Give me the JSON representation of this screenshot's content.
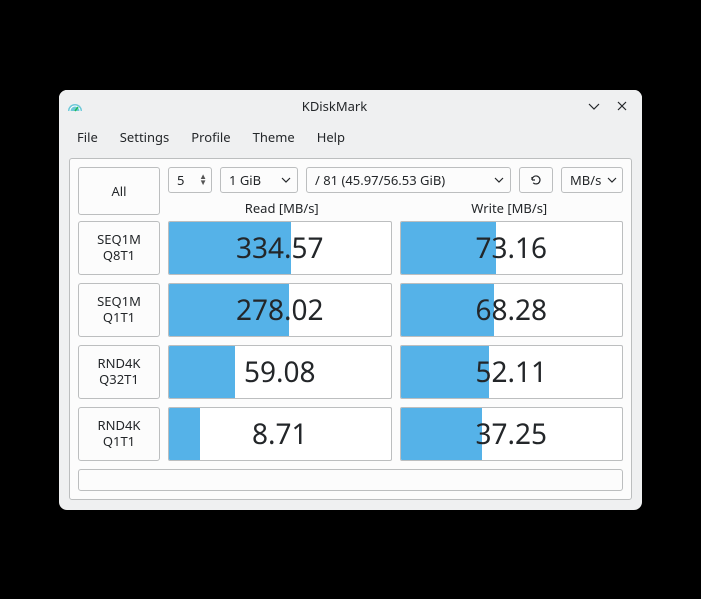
{
  "window": {
    "title": "KDiskMark"
  },
  "menu": {
    "file": "File",
    "settings": "Settings",
    "profile": "Profile",
    "theme": "Theme",
    "help": "Help"
  },
  "controls": {
    "all_label": "All",
    "runs": "5",
    "size": "1 GiB",
    "path": "/ 81 (45.97/56.53 GiB)",
    "units": "MB/s"
  },
  "headers": {
    "read": "Read [MB/s]",
    "write": "Write [MB/s]"
  },
  "tests": [
    {
      "name1": "SEQ1M",
      "name2": "Q8T1",
      "read": "334.57",
      "read_pct": 55,
      "write": "73.16",
      "write_pct": 43
    },
    {
      "name1": "SEQ1M",
      "name2": "Q1T1",
      "read": "278.02",
      "read_pct": 54,
      "write": "68.28",
      "write_pct": 42
    },
    {
      "name1": "RND4K",
      "name2": "Q32T1",
      "read": "59.08",
      "read_pct": 30,
      "write": "52.11",
      "write_pct": 40
    },
    {
      "name1": "RND4K",
      "name2": "Q1T1",
      "read": "8.71",
      "read_pct": 14,
      "write": "37.25",
      "write_pct": 37
    }
  ]
}
